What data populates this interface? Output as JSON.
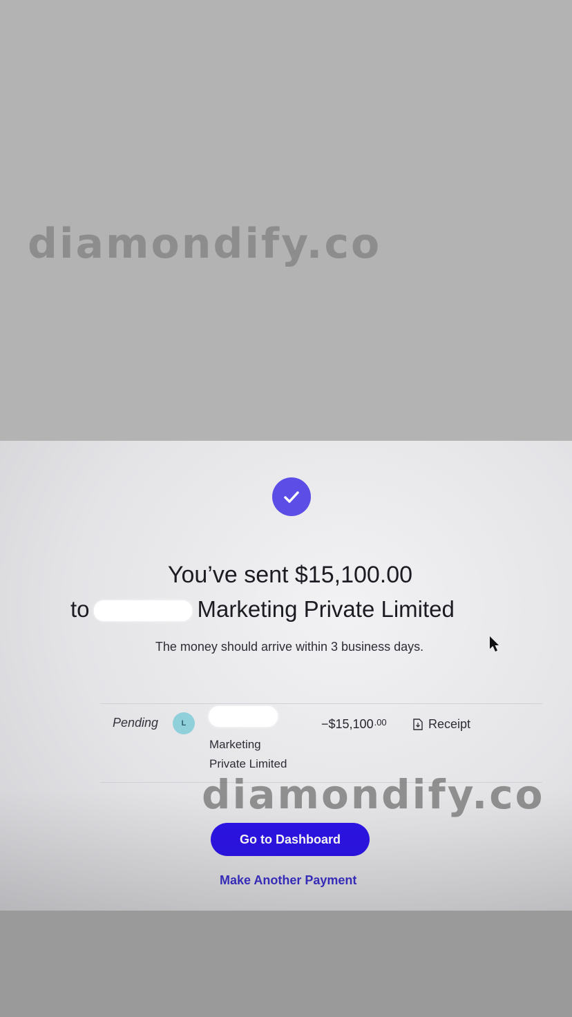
{
  "watermark": {
    "text": "diamondify.co"
  },
  "confirmation": {
    "headline_line1": "You’ve sent $15,100.00",
    "headline_prefix": "to",
    "headline_recipient": "Marketing Private Limited",
    "subtext": "The money should arrive within 3 business days."
  },
  "transaction": {
    "status": "Pending",
    "avatar_initial": "L",
    "recipient_line1": "Marketing",
    "recipient_line2": "Private Limited",
    "amount": "−$15,100",
    "amount_cents": ".00",
    "receipt_label": "Receipt"
  },
  "actions": {
    "primary": "Go to Dashboard",
    "secondary": "Make Another Payment"
  },
  "colors": {
    "accent": "#2d14e8",
    "check_circle": "#5b4de6",
    "link": "#3a2fc8",
    "avatar_bg": "#8fd0da"
  },
  "icons": [
    "check-icon",
    "cursor-icon",
    "receipt-icon"
  ]
}
